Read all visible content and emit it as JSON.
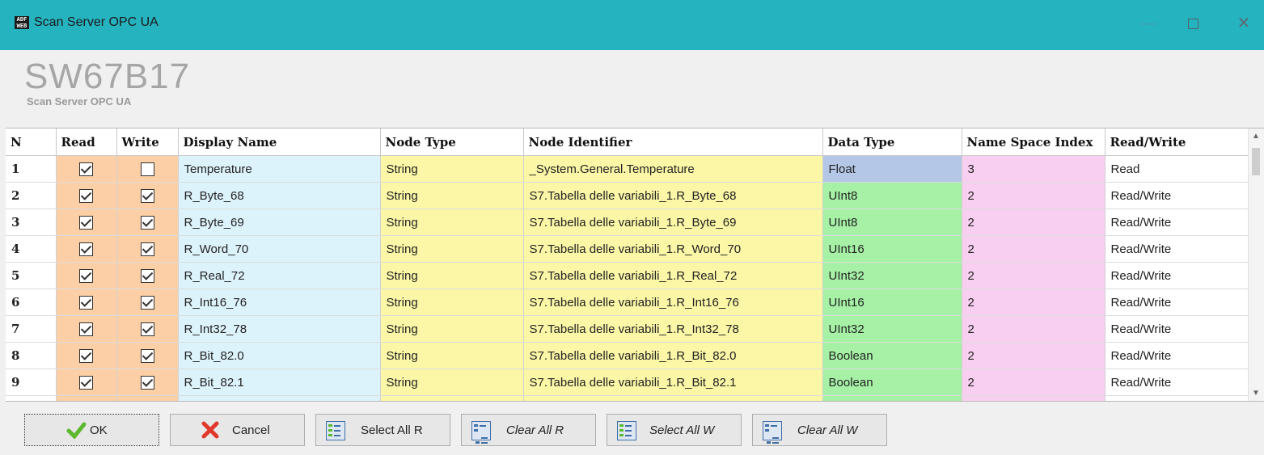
{
  "window": {
    "title": "Scan Server OPC UA",
    "app_icon_text": "ADF WEB",
    "minimize": "—",
    "close": "✕"
  },
  "header": {
    "logo": "SW67B17",
    "subtitle": "Scan Server OPC UA"
  },
  "table": {
    "columns": [
      "N",
      "Read",
      "Write",
      "Display Name",
      "Node Type",
      "Node Identifier",
      "Data Type",
      "Name Space Index",
      "Read/Write"
    ],
    "rows": [
      {
        "n": "1",
        "read": true,
        "write": false,
        "display_name": "Temperature",
        "node_type": "String",
        "node_id": "_System.General.Temperature",
        "data_type": "Float",
        "ns_index": "3",
        "rw": "Read"
      },
      {
        "n": "2",
        "read": true,
        "write": true,
        "display_name": "R_Byte_68",
        "node_type": "String",
        "node_id": "S7.Tabella delle variabili_1.R_Byte_68",
        "data_type": "UInt8",
        "ns_index": "2",
        "rw": "Read/Write"
      },
      {
        "n": "3",
        "read": true,
        "write": true,
        "display_name": "R_Byte_69",
        "node_type": "String",
        "node_id": "S7.Tabella delle variabili_1.R_Byte_69",
        "data_type": "UInt8",
        "ns_index": "2",
        "rw": "Read/Write"
      },
      {
        "n": "4",
        "read": true,
        "write": true,
        "display_name": "R_Word_70",
        "node_type": "String",
        "node_id": "S7.Tabella delle variabili_1.R_Word_70",
        "data_type": "UInt16",
        "ns_index": "2",
        "rw": "Read/Write"
      },
      {
        "n": "5",
        "read": true,
        "write": true,
        "display_name": "R_Real_72",
        "node_type": "String",
        "node_id": "S7.Tabella delle variabili_1.R_Real_72",
        "data_type": "UInt32",
        "ns_index": "2",
        "rw": "Read/Write"
      },
      {
        "n": "6",
        "read": true,
        "write": true,
        "display_name": "R_Int16_76",
        "node_type": "String",
        "node_id": "S7.Tabella delle variabili_1.R_Int16_76",
        "data_type": "UInt16",
        "ns_index": "2",
        "rw": "Read/Write"
      },
      {
        "n": "7",
        "read": true,
        "write": true,
        "display_name": "R_Int32_78",
        "node_type": "String",
        "node_id": "S7.Tabella delle variabili_1.R_Int32_78",
        "data_type": "UInt32",
        "ns_index": "2",
        "rw": "Read/Write"
      },
      {
        "n": "8",
        "read": true,
        "write": true,
        "display_name": "R_Bit_82.0",
        "node_type": "String",
        "node_id": "S7.Tabella delle variabili_1.R_Bit_82.0",
        "data_type": "Boolean",
        "ns_index": "2",
        "rw": "Read/Write"
      },
      {
        "n": "9",
        "read": true,
        "write": true,
        "display_name": "R_Bit_82.1",
        "node_type": "String",
        "node_id": "S7.Tabella delle variabili_1.R_Bit_82.1",
        "data_type": "Boolean",
        "ns_index": "2",
        "rw": "Read/Write"
      },
      {
        "n": "",
        "read": true,
        "write": true,
        "display_name": "",
        "node_type": "",
        "node_id": "",
        "data_type": "",
        "ns_index": "",
        "rw": ""
      }
    ]
  },
  "buttons": {
    "ok": "OK",
    "cancel": "Cancel",
    "select_all_r": "Select All R",
    "clear_all_r": "Clear All R",
    "select_all_w": "Select All W",
    "clear_all_w": "Clear All W"
  },
  "colors": {
    "titlebar": "#26b3c0",
    "read_write_col": "#fccfa6",
    "display_name_col": "#ddf3fb",
    "node_col": "#fbf7a7",
    "data_type_col": "#a6f1a6",
    "float_cell": "#b4c7e6",
    "ns_index_col": "#f8cff0"
  }
}
